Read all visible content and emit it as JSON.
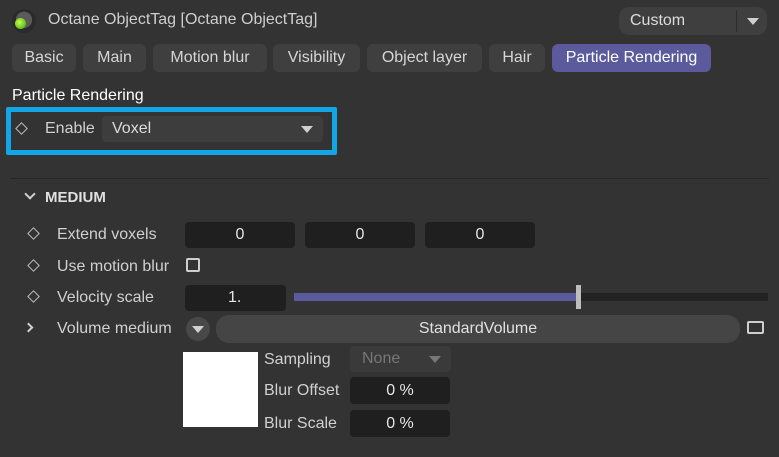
{
  "header": {
    "title": "Octane ObjectTag [Octane ObjectTag]",
    "preset": "Custom"
  },
  "tabs": [
    {
      "label": "Basic",
      "active": false
    },
    {
      "label": "Main",
      "active": false
    },
    {
      "label": "Motion blur",
      "active": false
    },
    {
      "label": "Visibility",
      "active": false
    },
    {
      "label": "Object layer",
      "active": false
    },
    {
      "label": "Hair",
      "active": false
    },
    {
      "label": "Particle Rendering",
      "active": true
    }
  ],
  "particle_rendering": {
    "heading": "Particle Rendering",
    "enable_label": "Enable",
    "enable_value": "Voxel"
  },
  "medium": {
    "heading": "MEDIUM",
    "extend_voxels_label": "Extend voxels",
    "extend_voxels_values": [
      "0",
      "0",
      "0"
    ],
    "use_motion_blur_label": "Use motion blur",
    "use_motion_blur_checked": false,
    "velocity_scale_label": "Velocity scale",
    "velocity_scale_value": "1.",
    "velocity_scale_slider_fraction": 0.6,
    "volume_medium_label": "Volume medium",
    "volume_medium_value": "StandardVolume",
    "sampling_label": "Sampling",
    "sampling_value": "None",
    "blur_offset_label": "Blur Offset",
    "blur_offset_value": "0 %",
    "blur_scale_label": "Blur Scale",
    "blur_scale_value": "0 %"
  },
  "colors": {
    "accent_tab": "#5b5a9c",
    "highlight": "#12a6e6",
    "slider_fill": "#5b5a9c"
  }
}
